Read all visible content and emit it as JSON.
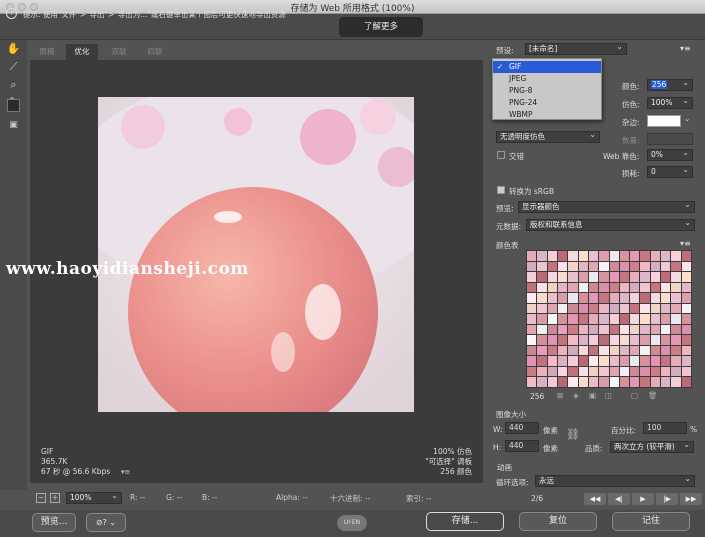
{
  "window": {
    "title": "存储为 Web 所用格式 (100%)"
  },
  "info": {
    "text": "提示: 使用\"文件\">\"导出\">\"导出为...\"或右键单击某个图层可更快速地导出资源",
    "learn_more": "了解更多"
  },
  "tabs": [
    "原稿",
    "优化",
    "双联",
    "四联"
  ],
  "active_tab": "优化",
  "image_info": {
    "left": [
      "GIF",
      "365.7K",
      "67 秒 @ 56.6 Kbps"
    ],
    "right": [
      "100% 仿色",
      "\"可选择\" 调板",
      "256 颜色"
    ]
  },
  "watermark": "www.haoyidiansheji.com",
  "statusbar": {
    "zoom": "100%",
    "r": "R: --",
    "g": "G: --",
    "b": "B: --",
    "alpha": "Alpha: --",
    "hex": "十六进制: --",
    "index": "索引: --"
  },
  "bottom": {
    "preview": "预览...",
    "save": "存储...",
    "reset": "复位",
    "remember": "记住"
  },
  "panel": {
    "preset_label": "预设:",
    "preset_value": "[未命名]",
    "format_options": [
      "GIF",
      "JPEG",
      "PNG-8",
      "PNG-24",
      "WBMP"
    ],
    "format_selected": "GIF",
    "colors_label": "颜色:",
    "colors_value": "256",
    "dither_label": "仿色:",
    "dither_value": "100%",
    "matte_label": "杂边:",
    "amount_label": "数量:",
    "transparency_dither": "无透明度仿色",
    "interlaced": "交错",
    "web_snap_label": "Web 靠色:",
    "web_snap_value": "0%",
    "lossy_label": "损耗:",
    "lossy_value": "0",
    "convert_srgb": "转换为 sRGB",
    "preview_label": "预览:",
    "preview_value": "显示器颜色",
    "metadata_label": "元数据:",
    "metadata_value": "版权和联系信息",
    "color_table_label": "颜色表",
    "color_count": "256",
    "image_size_label": "图像大小",
    "w_label": "W:",
    "w_value": "440",
    "h_label": "H:",
    "h_value": "440",
    "unit": "像素",
    "percent_label": "百分比:",
    "percent_value": "100",
    "percent_sign": "%",
    "quality_label": "品质:",
    "quality_value": "两次立方 (较平滑)",
    "animation_label": "动画",
    "loop_label": "循环选项:",
    "loop_value": "永远",
    "frame": "2/6"
  }
}
